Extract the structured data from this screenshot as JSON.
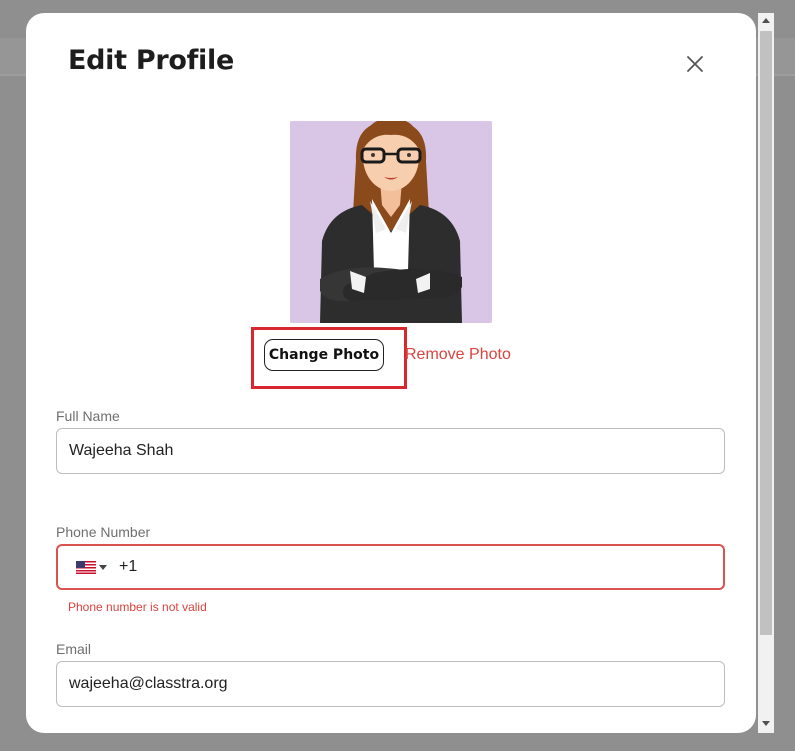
{
  "modal": {
    "title": "Edit Profile",
    "close_icon": "close-icon"
  },
  "photo": {
    "avatar_icon": "avatar-illustration",
    "change_label": "Change Photo",
    "remove_label": "Remove Photo"
  },
  "fields": {
    "full_name": {
      "label": "Full Name",
      "value": "Wajeeha Shah"
    },
    "phone": {
      "label": "Phone Number",
      "country_icon": "us-flag-icon",
      "value": "+1",
      "error": "Phone number is not valid"
    },
    "email": {
      "label": "Email",
      "value": "wajeeha@classtra.org"
    }
  },
  "colors": {
    "accent_red": "#d9443f",
    "highlight_red": "#d9272f",
    "avatar_bg": "#d9c6e6"
  }
}
